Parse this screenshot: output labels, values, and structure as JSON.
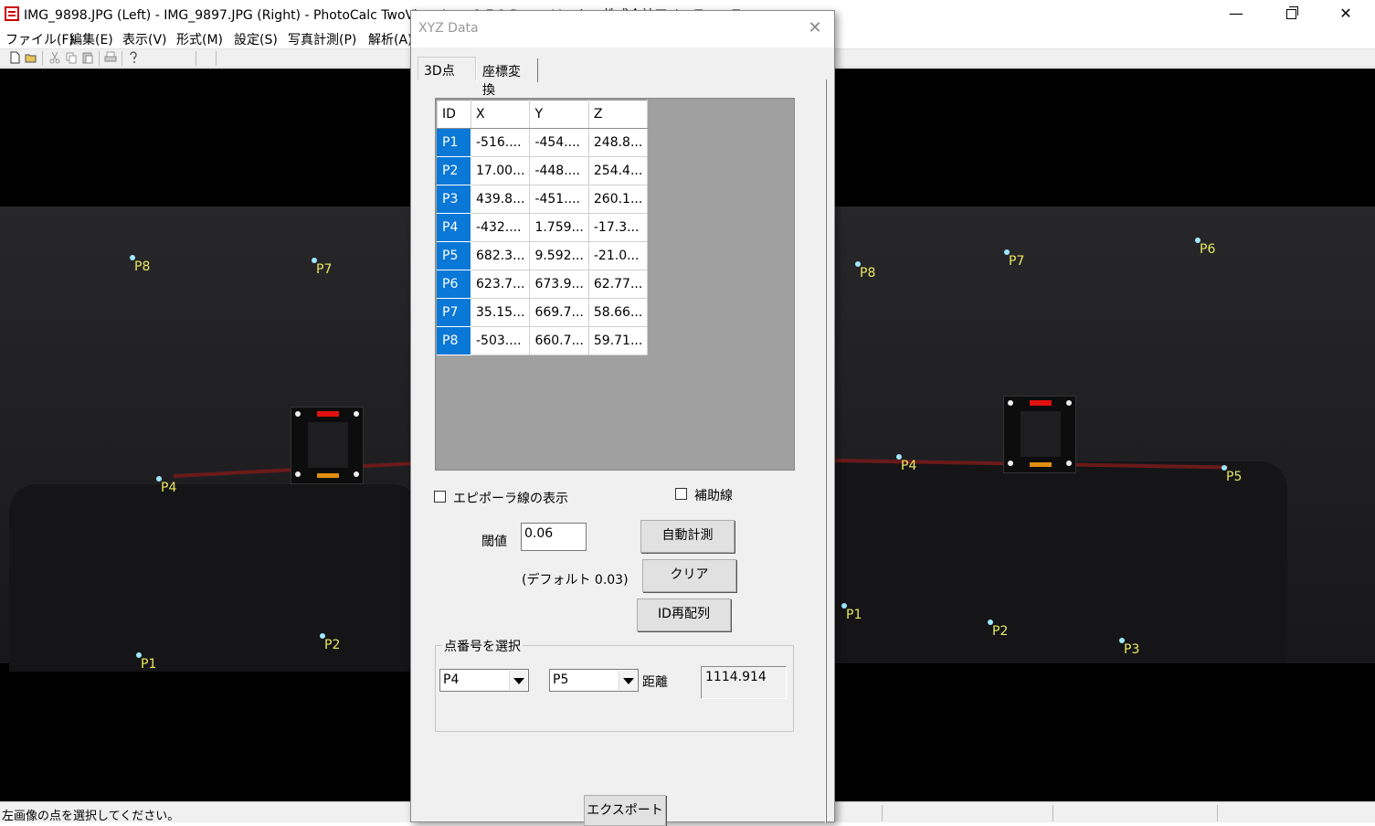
{
  "window": {
    "title": "IMG_9898.JPG (Left) - IMG_9897.JPG (Right) - PhotoCalc TwoView Auto 3.7.1 Demo Version  株式会社アイ・ティ・ティ",
    "minimize_glyph": "—",
    "close_glyph": "✕"
  },
  "menu": [
    {
      "label": "ファイル(F)"
    },
    {
      "label": "編集(E)"
    },
    {
      "label": "表示(V)"
    },
    {
      "label": "形式(M)"
    },
    {
      "label": "設定(S)"
    },
    {
      "label": "写真計測(P)"
    },
    {
      "label": "解析(A)"
    }
  ],
  "left_markers": [
    {
      "label": "P8"
    },
    {
      "label": "P7"
    },
    {
      "label": "P4"
    },
    {
      "label": "P2"
    },
    {
      "label": "P1"
    }
  ],
  "right_markers": [
    {
      "label": "P6"
    },
    {
      "label": "P7"
    },
    {
      "label": "P8"
    },
    {
      "label": "P4"
    },
    {
      "label": "P5"
    },
    {
      "label": "P1"
    },
    {
      "label": "P2"
    },
    {
      "label": "P3"
    }
  ],
  "status": {
    "text": "左画像の点を選択してください。"
  },
  "dialog": {
    "title": "XYZ Data",
    "close_glyph": "✕",
    "tabs": [
      {
        "label": "3D点"
      },
      {
        "label": "座標変換"
      }
    ],
    "table": {
      "headers": [
        "ID",
        "X",
        "Y",
        "Z"
      ],
      "rows": [
        {
          "id": "P1",
          "x": "-516....",
          "y": "-454....",
          "z": "248.8..."
        },
        {
          "id": "P2",
          "x": "17.00...",
          "y": "-448....",
          "z": "254.4..."
        },
        {
          "id": "P3",
          "x": "439.8...",
          "y": "-451....",
          "z": "260.1..."
        },
        {
          "id": "P4",
          "x": "-432....",
          "y": "1.759...",
          "z": "-17.3..."
        },
        {
          "id": "P5",
          "x": "682.3...",
          "y": "9.592...",
          "z": "-21.0..."
        },
        {
          "id": "P6",
          "x": "623.7...",
          "y": "673.9...",
          "z": "62.77..."
        },
        {
          "id": "P7",
          "x": "35.15...",
          "y": "669.7...",
          "z": "58.66..."
        },
        {
          "id": "P8",
          "x": "-503....",
          "y": "660.7...",
          "z": "59.71..."
        }
      ]
    },
    "epipolar_label": "エピポーラ線の表示",
    "aux_line_label": "補助線",
    "threshold_label": "閾値",
    "threshold_value": "0.06",
    "default_note": "(デフォルト 0.03)",
    "auto_measure_button": "自動計測",
    "clear_button": "クリア",
    "reorder_id_button": "ID再配列",
    "point_select_group": "点番号を選択",
    "point_a": "P4",
    "point_b": "P5",
    "distance_label": "距離",
    "distance_value": "1114.914",
    "export_button": "エクスポート"
  },
  "colors": {
    "selection_blue": "#0a78d7",
    "marker_yellow": "#e8e860",
    "marker_dot": "#9ee8ff",
    "target_red": "#e01010",
    "target_orange": "#e09010"
  }
}
